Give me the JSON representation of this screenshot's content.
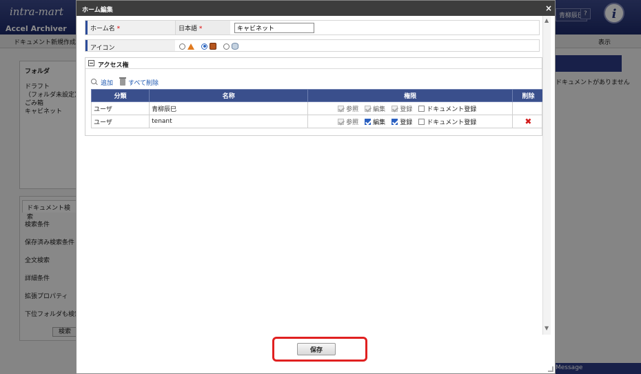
{
  "background": {
    "logo": "intra-mart",
    "app_name": "Accel Archiver",
    "user_name": "青柳辰巳",
    "help": "?",
    "new_document": "ドキュメント新規作成",
    "display": "表示",
    "folder_title": "フォルダ",
    "tree": [
      "ドラフト",
      "（フォルダ未設定）",
      "ごみ箱",
      "キャビネット"
    ],
    "search_tab": "ドキュメント検索",
    "search_items": [
      "検索条件",
      "保存済み検索条件",
      "全文検索",
      "詳細条件",
      "拡張プロパティ",
      "下位フォルダも検索"
    ],
    "search_button": "検索",
    "right_text": "ドキュメントがありません",
    "message": "Message"
  },
  "dialog": {
    "title": "ホーム編集",
    "close_glyph": "×",
    "name_label": "ホーム名",
    "required_mark": "*",
    "language_label": "日本語",
    "name_value": "キャビネット",
    "icon_label": "アイコン",
    "icon_options": [
      "cone-icon",
      "cabinet-icon",
      "database-icon"
    ],
    "icon_selected": 1
  },
  "access": {
    "title": "アクセス権",
    "add_label": "追加",
    "delete_all_label": "すべて削除",
    "columns": [
      "分類",
      "名称",
      "権限",
      "削除"
    ],
    "permission_labels": [
      "参照",
      "編集",
      "登録",
      "ドキュメント登録"
    ],
    "rows": [
      {
        "type": "ユーザ",
        "name": "青柳辰巳",
        "perms": [
          true,
          true,
          true,
          false
        ],
        "editable": false
      },
      {
        "type": "ユーザ",
        "name": "tenant",
        "perms": [
          true,
          true,
          true,
          false
        ],
        "editable": true
      }
    ],
    "delete_glyph": "✖"
  },
  "footer": {
    "save_label": "保存",
    "highlight_color": "#e02020"
  }
}
